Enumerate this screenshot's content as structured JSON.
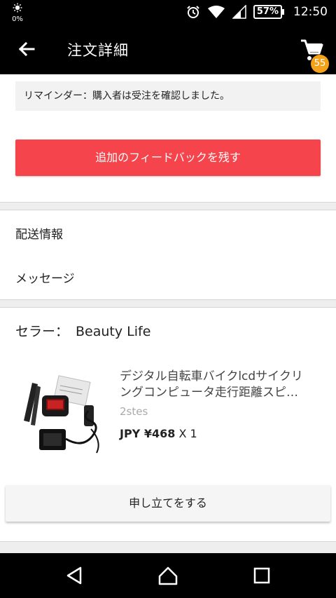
{
  "status_bar": {
    "data_saver": "0%",
    "battery": "57%",
    "time": "12:50"
  },
  "app_bar": {
    "title": "注文詳細",
    "cart_count": "55"
  },
  "reminder": "リマインダー：購入者は受注を確認しました。",
  "feedback_button": "追加のフィードバックを残す",
  "links": {
    "shipping_info": "配送情報",
    "message": "メッセージ"
  },
  "seller": {
    "label": "セラー：",
    "name": "Beauty Life"
  },
  "product": {
    "title_line1": "デジタル自転車バイクlcdサイクリ",
    "title_line2": "ングコンピュータ走行距離スピ…",
    "variant": "2stes",
    "price": "JPY ¥468",
    "quantity": "X 1"
  },
  "dispute_button": "申し立てをする",
  "icons": {
    "back": "arrow-left",
    "cart": "shopping-cart",
    "nav_back": "triangle-back",
    "nav_home": "circle-home",
    "nav_recents": "square-recents"
  }
}
